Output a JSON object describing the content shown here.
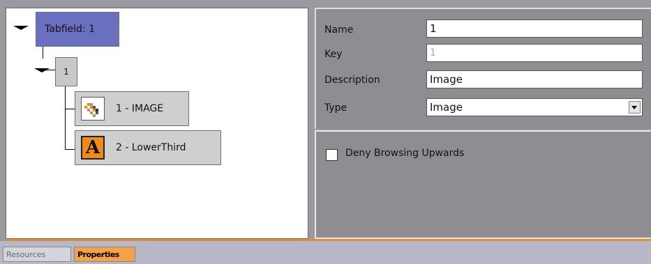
{
  "tree": {
    "root_label": "Tabfield: 1",
    "child_label": "1",
    "items": [
      {
        "label": "1 - IMAGE",
        "icon": "image-icon"
      },
      {
        "label": "2 - LowerThird",
        "icon": "lower-third-icon",
        "icon_glyph": "A"
      }
    ]
  },
  "properties": {
    "name_label": "Name",
    "name_value": "1",
    "key_label": "Key",
    "key_value": "1",
    "description_label": "Description",
    "description_value": "Image",
    "type_label": "Type",
    "type_value": "Image"
  },
  "options": {
    "deny_browsing_label": "Deny Browsing Upwards",
    "deny_browsing_checked": false
  },
  "tabs": {
    "resources": "Resources",
    "properties": "Properties"
  },
  "colors": {
    "root_node": "#6b6fc0",
    "active_tab": "#f3a24a",
    "lower_third_icon": "#f08a1a"
  }
}
